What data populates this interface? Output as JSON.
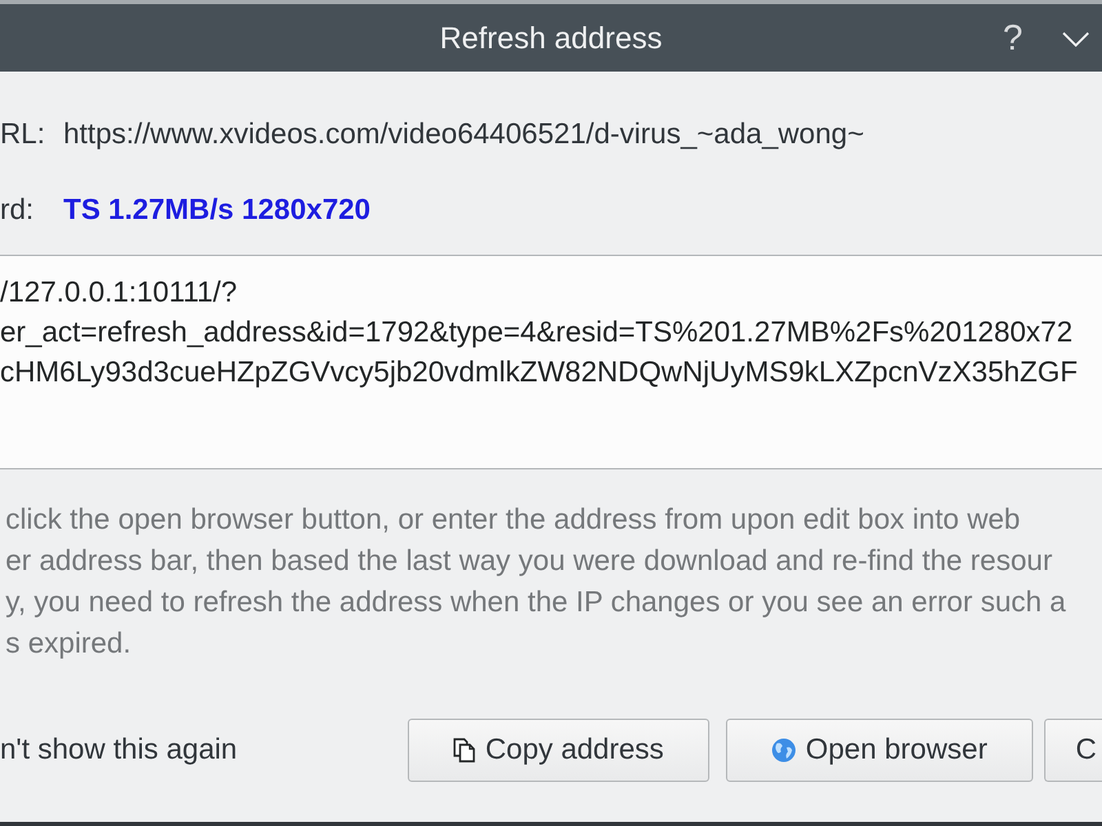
{
  "window": {
    "title": "Refresh address",
    "help": "?"
  },
  "fields": [
    {
      "label": "RL:",
      "value": "https://www.xvideos.com/video64406521/d-virus_~ada_wong~",
      "kind": "url"
    },
    {
      "label": "rd:",
      "value": "TS 1.27MB/s 1280x720",
      "kind": "resource"
    }
  ],
  "address_box": {
    "lines": [
      "/127.0.0.1:10111/?",
      "er_act=refresh_address&id=1792&type=4&resid=TS%201.27MB%2Fs%201280x72",
      "cHM6Ly93d3cueHZpZGVvcy5jb20vdmlkZW82NDQwNjUyMS9kLXZpcnVzX35hZGF"
    ]
  },
  "hint": {
    "lines": [
      "click the open browser button, or enter the address from upon edit box into web",
      "er address bar, then based the last way you were download and re-find the resour",
      "y, you need to refresh the address when the IP changes or you see an error such a",
      "s expired."
    ]
  },
  "dont_show_again": {
    "label": "n't show this again"
  },
  "buttons": [
    {
      "label": "Copy address",
      "kind": "copy"
    },
    {
      "label": "Open browser",
      "kind": "browse"
    },
    {
      "label": "C",
      "kind": "cut"
    }
  ]
}
